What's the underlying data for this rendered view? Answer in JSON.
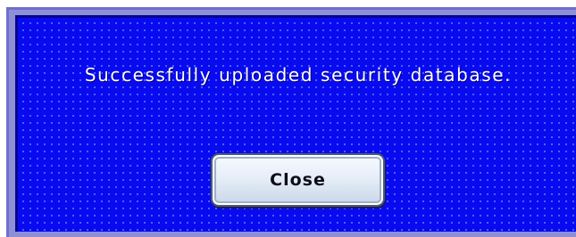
{
  "dialog": {
    "message": "Successfully uploaded security database.",
    "close_label": "Close"
  },
  "colors": {
    "background": "#0a0af0",
    "dot_pattern": "#5a8cff",
    "border": "#8f8fd6",
    "text": "#ffffff",
    "button_face": "#e6eef8"
  }
}
